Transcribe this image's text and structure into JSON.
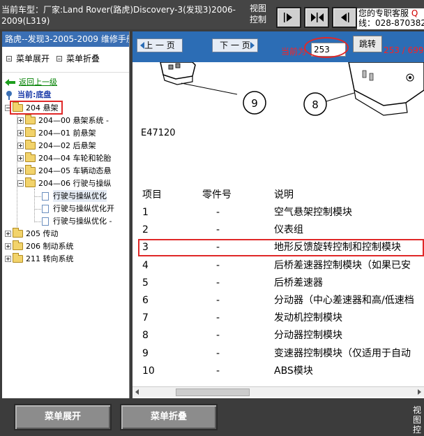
{
  "header": {
    "car_info": "当前车型：厂家:Land Rover(路虎)Discovery-3(发现3)2006-2009(L319)",
    "view_control": "视图控制",
    "service_line1": "您的专职客服 ",
    "service_q": "Q",
    "service_line2": "线：028-870382"
  },
  "sidebar": {
    "title": "路虎--发现3-2005-2009 维修手册",
    "expand_label": "菜单展开",
    "collapse_label": "菜单折叠",
    "back_label": "返回上一级",
    "current_label": "当前:底盘",
    "tree": [
      {
        "label": "204 悬架"
      },
      {
        "label": "204—00 悬架系统 -"
      },
      {
        "label": "204—01 前悬架"
      },
      {
        "label": "204—02 后悬架"
      },
      {
        "label": "204—04 车轮和轮胎"
      },
      {
        "label": "204—05 车辆动态悬"
      },
      {
        "label": "204—06 行驶与操纵"
      },
      {
        "label": "行驶与操纵优化"
      },
      {
        "label": "行驶与操纵优化开"
      },
      {
        "label": "行驶与操纵优化 -"
      },
      {
        "label": "205 传动"
      },
      {
        "label": "206 制动系统"
      },
      {
        "label": "211 转向系统"
      }
    ]
  },
  "pager": {
    "prev_label": "上 一 页",
    "next_label": "下 一 页",
    "current_label": "当前为",
    "current_page": "253",
    "jump_label": "跳转",
    "total": "253 / 699"
  },
  "figure": {
    "callout_9": "9",
    "callout_8": "8",
    "code": "E47120"
  },
  "table": {
    "headers": {
      "item": "项目",
      "part": "零件号",
      "desc": "说明"
    },
    "rows": [
      {
        "item": "1",
        "part": "-",
        "desc": "空气悬架控制模块"
      },
      {
        "item": "2",
        "part": "-",
        "desc": "仪表组"
      },
      {
        "item": "3",
        "part": "-",
        "desc": "地形反馈旋转控制和控制模块"
      },
      {
        "item": "4",
        "part": "-",
        "desc": "后桥差速器控制模块（如果已安"
      },
      {
        "item": "5",
        "part": "-",
        "desc": "后桥差速器"
      },
      {
        "item": "6",
        "part": "-",
        "desc": "分动器（中心差速器和高/低速档"
      },
      {
        "item": "7",
        "part": "-",
        "desc": "发动机控制模块"
      },
      {
        "item": "8",
        "part": "-",
        "desc": "分动器控制模块"
      },
      {
        "item": "9",
        "part": "-",
        "desc": "变速器控制模块（仅适用于自动"
      },
      {
        "item": "10",
        "part": "-",
        "desc": "ABS模块"
      }
    ]
  },
  "bottom": {
    "expand_label": "菜单展开",
    "collapse_label": "菜单折叠",
    "view_control": "视图控"
  },
  "colors": {
    "accent_blue": "#2c6db5",
    "highlight_red": "#e02828",
    "folder_yellow": "#f2d36b"
  }
}
